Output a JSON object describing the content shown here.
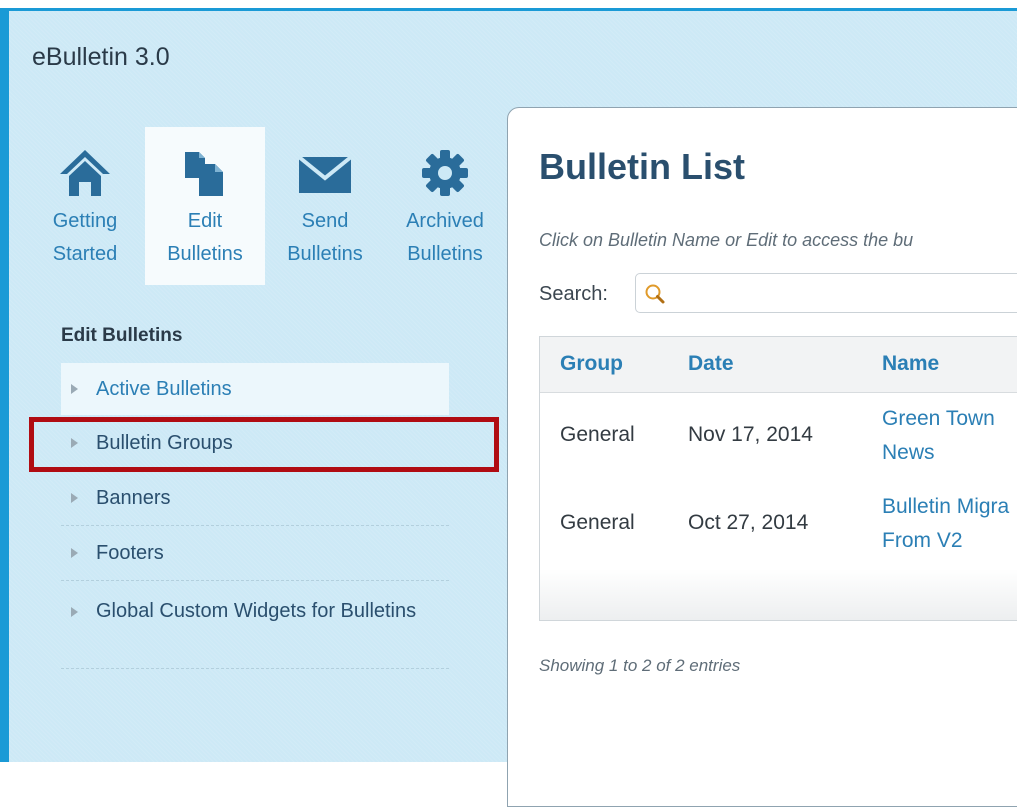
{
  "app": {
    "title": "eBulletin 3.0"
  },
  "nav": {
    "items": [
      {
        "id": "getting-started",
        "line1": "Getting",
        "line2": "Started",
        "icon": "home-icon",
        "active": false
      },
      {
        "id": "edit-bulletins",
        "line1": "Edit",
        "line2": "Bulletins",
        "icon": "documents-icon",
        "active": true
      },
      {
        "id": "send-bulletins",
        "line1": "Send",
        "line2": "Bulletins",
        "icon": "envelope-icon",
        "active": false
      },
      {
        "id": "archived-bulletins",
        "line1": "Archived",
        "line2": "Bulletins",
        "icon": "gear-icon",
        "active": false
      }
    ]
  },
  "sidebar": {
    "heading": "Edit Bulletins",
    "items": [
      {
        "label": "Active Bulletins",
        "active": true
      },
      {
        "label": "Bulletin Groups",
        "active": false,
        "highlighted": true
      },
      {
        "label": "Banners",
        "active": false
      },
      {
        "label": "Footers",
        "active": false
      },
      {
        "label": "Global Custom Widgets for Bulletins",
        "active": false
      }
    ]
  },
  "main": {
    "title": "Bulletin List",
    "instructions": "Click on Bulletin Name or Edit to access the bu",
    "search": {
      "label": "Search:",
      "value": "",
      "placeholder": ""
    },
    "table": {
      "columns": [
        "Group",
        "Date",
        "Name"
      ],
      "rows": [
        {
          "group": "General",
          "date": "Nov 17, 2014",
          "name_line1": "Green Town",
          "name_line2": "News"
        },
        {
          "group": "General",
          "date": "Oct 27, 2014",
          "name_line1": "Bulletin Migra",
          "name_line2": "From V2"
        }
      ]
    },
    "entries_info": "Showing 1 to 2 of 2 entries"
  },
  "colors": {
    "window_border": "#1a9ad6",
    "background": "#cde9f6",
    "accent_link": "#2b7fb5",
    "highlight": "#b00c12",
    "icon": "#2a6c9a"
  }
}
